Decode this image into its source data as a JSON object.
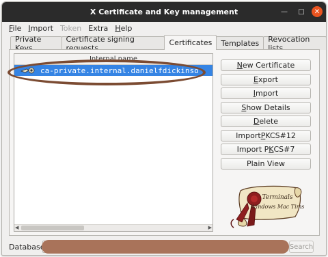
{
  "window": {
    "title": "X Certificate and Key management"
  },
  "menu": [
    {
      "label": "File",
      "underline": "F",
      "rest": "ile",
      "enabled": true
    },
    {
      "label": "Import",
      "underline": "I",
      "rest": "mport",
      "enabled": true
    },
    {
      "label": "Token",
      "enabled": false
    },
    {
      "label": "Extra",
      "underline": "",
      "rest": "Extra",
      "enabled": true
    },
    {
      "label": "Help",
      "underline": "H",
      "rest": "elp",
      "enabled": true
    }
  ],
  "tabs": [
    {
      "label": "Private Keys"
    },
    {
      "label": "Certificate signing requests"
    },
    {
      "label": "Certificates",
      "active": true
    },
    {
      "label": "Templates"
    },
    {
      "label": "Revocation lists"
    }
  ],
  "list": {
    "column_header": "Internal name",
    "selected_row": "ca-private.internal.danielfdickinso"
  },
  "buttons": {
    "new_certificate": "New Certificate",
    "export": "Export",
    "import": "Import",
    "show_details": "Show Details",
    "delete": "Delete",
    "import_pkcs12": "Import PKCS#12",
    "import_pkcs7": "Import PKCS#7",
    "plain_view": "Plain View"
  },
  "stamp": {
    "line1": "Terminals",
    "line2": "Windows Mac Tims"
  },
  "bottom": {
    "database_label": "Database:",
    "search_label": "Search"
  },
  "colors": {
    "titlebar": "#2b2b2b",
    "selection": "#3584e4",
    "close": "#e95420",
    "redaction": "#a9735a"
  }
}
